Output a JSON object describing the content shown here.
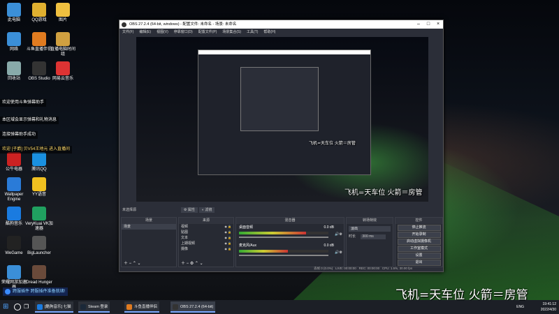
{
  "colors": {
    "accent": "#7aa8ff",
    "obs_bg": "#2b2e38",
    "stream_green": "#46be46"
  },
  "desktop": {
    "icons": [
      {
        "label": "此电脑"
      },
      {
        "label": "QQ游戏"
      },
      {
        "label": "图片"
      },
      {
        "label": "网络"
      },
      {
        "label": "斗鱼直播伴侣"
      },
      {
        "label": "直播电脑时间组"
      },
      {
        "label": "回收站"
      },
      {
        "label": "OBS Studio"
      },
      {
        "label": "网易云音乐"
      },
      {
        "label": "Wallpaper Engine"
      },
      {
        "label": "YY语音"
      },
      {
        "label": "酷狗音乐"
      },
      {
        "label": "VeryKuai VK加速器"
      },
      {
        "label": "WeGame"
      },
      {
        "label": "BigLauncher"
      },
      {
        "label": "荣耀网游加速器"
      },
      {
        "label": "Dread Hunger"
      },
      {
        "label": "公牛电器"
      },
      {
        "label": "腾讯QQ"
      }
    ]
  },
  "chat": [
    {
      "text": "欢迎使用斗鱼弹幕助手"
    },
    {
      "text": "本区域会显示弹幕和礼物消息"
    },
    {
      "text": "连接弹幕助手成功"
    },
    {
      "text": "欢迎 [子爵] 贝V54王地元 进入直播间"
    }
  ],
  "banner": {
    "text": "跨服插件 跨服插件准备就绪!"
  },
  "overlay_caption": "飞机=天车位 火箭＝房管",
  "obs": {
    "title": "OBS 27.2.4 (64-bit, windows) - 配置文件: 未命名 - 场景: 未命名",
    "menu": [
      "文件(F)",
      "编辑(E)",
      "视图(V)",
      "停靠窗口(D)",
      "配置文件(P)",
      "场景集合(S)",
      "工具(T)",
      "帮助(H)"
    ],
    "preview_caption": "飞机=天车位 火箭＝房管",
    "inner_caption": "飞机=天车位 火箭＝房管",
    "no_source_label": "未选择源",
    "props_label": "属性",
    "filters_label": "滤镜",
    "docks": {
      "scenes": {
        "title": "场景",
        "items": [
          "场景"
        ]
      },
      "sources": {
        "title": "来源",
        "items": [
          "视频",
          "贴图",
          "文本",
          "上期视频",
          "摄像"
        ]
      },
      "mixer": {
        "title": "混音器",
        "tracks": [
          {
            "name": "桌面音频",
            "db": "0.0 dB",
            "level": 0.75
          },
          {
            "name": "麦克风/Aux",
            "db": "0.0 dB",
            "level": 0.55
          }
        ]
      },
      "transitions": {
        "title": "转场特效",
        "type": "淡出",
        "duration_label": "时长",
        "duration": "300 ms"
      },
      "controls": {
        "title": "控件",
        "buttons": [
          "停止推流",
          "开始录制",
          "启动虚拟摄像机",
          "工作室模式",
          "设置",
          "退出"
        ]
      }
    },
    "status": {
      "dropped": "丢帧 0 (0.0%)",
      "live": "LIVE: 00:00:00",
      "rec": "REC: 00:00:00",
      "cpu": "CPU: 1.5%, 30.00 fps",
      "bitrate": "kb/s: 0"
    }
  },
  "taskbar": {
    "items": [
      {
        "label": "[酷狗音乐] 七猫"
      },
      {
        "label": "Steam 登录"
      },
      {
        "label": "斗鱼直播伴侣"
      },
      {
        "label": "OBS 27.2.4 (64-bit)"
      }
    ],
    "lang": "ENG",
    "time": "19:41:12",
    "date": "2022/4/30"
  }
}
